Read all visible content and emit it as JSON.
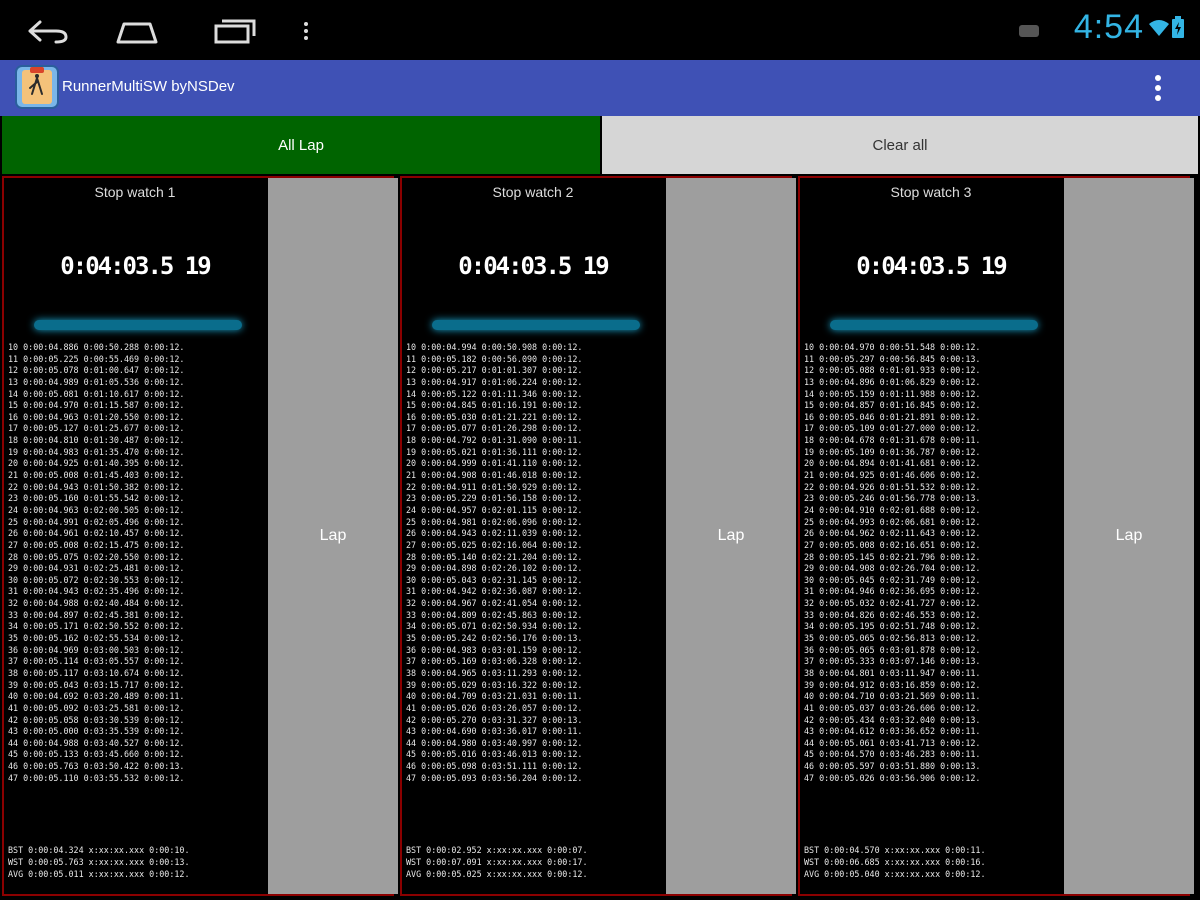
{
  "status_bar": {
    "time": "4:54",
    "icons": [
      "back-icon",
      "home-icon",
      "recent-apps-icon",
      "menu-icon",
      "notification-icon",
      "wifi-icon",
      "battery-icon"
    ],
    "time_color": "#33b5e5"
  },
  "app_bar": {
    "title": "RunnerMultiSW byNSDev",
    "color": "#3f51b5"
  },
  "buttons": {
    "all_lap": "All Lap",
    "clear_all": "Clear all"
  },
  "stopwatches": [
    {
      "title": "Stop watch 1",
      "time": "0:04:03.5 19",
      "lap_label": "Lap",
      "laps": [
        "10 0:00:04.886 0:00:50.288 0:00:12.",
        "11 0:00:05.225 0:00:55.469 0:00:12.",
        "12 0:00:05.078 0:01:00.647 0:00:12.",
        "13 0:00:04.989 0:01:05.536 0:00:12.",
        "14 0:00:05.081 0:01:10.617 0:00:12.",
        "15 0:00:04.970 0:01:15.587 0:00:12.",
        "16 0:00:04.963 0:01:20.550 0:00:12.",
        "17 0:00:05.127 0:01:25.677 0:00:12.",
        "18 0:00:04.810 0:01:30.487 0:00:12.",
        "19 0:00:04.983 0:01:35.470 0:00:12.",
        "20 0:00:04.925 0:01:40.395 0:00:12.",
        "21 0:00:05.008 0:01:45.403 0:00:12.",
        "22 0:00:04.943 0:01:50.382 0:00:12.",
        "23 0:00:05.160 0:01:55.542 0:00:12.",
        "24 0:00:04.963 0:02:00.505 0:00:12.",
        "25 0:00:04.991 0:02:05.496 0:00:12.",
        "26 0:00:04.961 0:02:10.457 0:00:12.",
        "27 0:00:05.008 0:02:15.475 0:00:12.",
        "28 0:00:05.075 0:02:20.550 0:00:12.",
        "29 0:00:04.931 0:02:25.481 0:00:12.",
        "30 0:00:05.072 0:02:30.553 0:00:12.",
        "31 0:00:04.943 0:02:35.496 0:00:12.",
        "32 0:00:04.988 0:02:40.484 0:00:12.",
        "33 0:00:04.897 0:02:45.381 0:00:12.",
        "34 0:00:05.171 0:02:50.552 0:00:12.",
        "35 0:00:05.162 0:02:55.534 0:00:12.",
        "36 0:00:04.969 0:03:00.503 0:00:12.",
        "37 0:00:05.114 0:03:05.557 0:00:12.",
        "38 0:00:05.117 0:03:10.674 0:00:12.",
        "39 0:00:05.043 0:03:15.717 0:00:12.",
        "40 0:00:04.692 0:03:20.489 0:00:11.",
        "41 0:00:05.092 0:03:25.581 0:00:12.",
        "42 0:00:05.058 0:03:30.539 0:00:12.",
        "43 0:00:05.000 0:03:35.539 0:00:12.",
        "44 0:00:04.988 0:03:40.527 0:00:12.",
        "45 0:00:05.133 0:03:45.660 0:00:12.",
        "46 0:00:05.763 0:03:50.422 0:00:13.",
        "47 0:00:05.110 0:03:55.532 0:00:12."
      ],
      "stats": [
        "BST 0:00:04.324 x:xx:xx.xxx 0:00:10.",
        "WST 0:00:05.763 x:xx:xx.xxx 0:00:13.",
        "AVG 0:00:05.011 x:xx:xx.xxx 0:00:12."
      ]
    },
    {
      "title": "Stop watch 2",
      "time": "0:04:03.5 19",
      "lap_label": "Lap",
      "laps": [
        "10 0:00:04.994 0:00:50.908 0:00:12.",
        "11 0:00:05.182 0:00:56.090 0:00:12.",
        "12 0:00:05.217 0:01:01.307 0:00:12.",
        "13 0:00:04.917 0:01:06.224 0:00:12.",
        "14 0:00:05.122 0:01:11.346 0:00:12.",
        "15 0:00:04.845 0:01:16.191 0:00:12.",
        "16 0:00:05.030 0:01:21.221 0:00:12.",
        "17 0:00:05.077 0:01:26.298 0:00:12.",
        "18 0:00:04.792 0:01:31.090 0:00:11.",
        "19 0:00:05.021 0:01:36.111 0:00:12.",
        "20 0:00:04.999 0:01:41.110 0:00:12.",
        "21 0:00:04.908 0:01:46.018 0:00:12.",
        "22 0:00:04.911 0:01:50.929 0:00:12.",
        "23 0:00:05.229 0:01:56.158 0:00:12.",
        "24 0:00:04.957 0:02:01.115 0:00:12.",
        "25 0:00:04.981 0:02:06.096 0:00:12.",
        "26 0:00:04.943 0:02:11.039 0:00:12.",
        "27 0:00:05.025 0:02:16.064 0:00:12.",
        "28 0:00:05.140 0:02:21.204 0:00:12.",
        "29 0:00:04.898 0:02:26.102 0:00:12.",
        "30 0:00:05.043 0:02:31.145 0:00:12.",
        "31 0:00:04.942 0:02:36.087 0:00:12.",
        "32 0:00:04.967 0:02:41.054 0:00:12.",
        "33 0:00:04.809 0:02:45.863 0:00:12.",
        "34 0:00:05.071 0:02:50.934 0:00:12.",
        "35 0:00:05.242 0:02:56.176 0:00:13.",
        "36 0:00:04.983 0:03:01.159 0:00:12.",
        "37 0:00:05.169 0:03:06.328 0:00:12.",
        "38 0:00:04.965 0:03:11.293 0:00:12.",
        "39 0:00:05.029 0:03:16.322 0:00:12.",
        "40 0:00:04.709 0:03:21.031 0:00:11.",
        "41 0:00:05.026 0:03:26.057 0:00:12.",
        "42 0:00:05.270 0:03:31.327 0:00:13.",
        "43 0:00:04.690 0:03:36.017 0:00:11.",
        "44 0:00:04.980 0:03:40.997 0:00:12.",
        "45 0:00:05.016 0:03:46.013 0:00:12.",
        "46 0:00:05.098 0:03:51.111 0:00:12.",
        "47 0:00:05.093 0:03:56.204 0:00:12."
      ],
      "stats": [
        "BST 0:00:02.952 x:xx:xx.xxx 0:00:07.",
        "WST 0:00:07.091 x:xx:xx.xxx 0:00:17.",
        "AVG 0:00:05.025 x:xx:xx.xxx 0:00:12."
      ]
    },
    {
      "title": "Stop watch 3",
      "time": "0:04:03.5 19",
      "lap_label": "Lap",
      "laps": [
        "10 0:00:04.970 0:00:51.548 0:00:12.",
        "11 0:00:05.297 0:00:56.845 0:00:13.",
        "12 0:00:05.088 0:01:01.933 0:00:12.",
        "13 0:00:04.896 0:01:06.829 0:00:12.",
        "14 0:00:05.159 0:01:11.988 0:00:12.",
        "15 0:00:04.857 0:01:16.845 0:00:12.",
        "16 0:00:05.046 0:01:21.891 0:00:12.",
        "17 0:00:05.109 0:01:27.000 0:00:12.",
        "18 0:00:04.678 0:01:31.678 0:00:11.",
        "19 0:00:05.109 0:01:36.787 0:00:12.",
        "20 0:00:04.894 0:01:41.681 0:00:12.",
        "21 0:00:04.925 0:01:46.606 0:00:12.",
        "22 0:00:04.926 0:01:51.532 0:00:12.",
        "23 0:00:05.246 0:01:56.778 0:00:13.",
        "24 0:00:04.910 0:02:01.688 0:00:12.",
        "25 0:00:04.993 0:02:06.681 0:00:12.",
        "26 0:00:04.962 0:02:11.643 0:00:12.",
        "27 0:00:05.008 0:02:16.651 0:00:12.",
        "28 0:00:05.145 0:02:21.796 0:00:12.",
        "29 0:00:04.908 0:02:26.704 0:00:12.",
        "30 0:00:05.045 0:02:31.749 0:00:12.",
        "31 0:00:04.946 0:02:36.695 0:00:12.",
        "32 0:00:05.032 0:02:41.727 0:00:12.",
        "33 0:00:04.826 0:02:46.553 0:00:12.",
        "34 0:00:05.195 0:02:51.748 0:00:12.",
        "35 0:00:05.065 0:02:56.813 0:00:12.",
        "36 0:00:05.065 0:03:01.878 0:00:12.",
        "37 0:00:05.333 0:03:07.146 0:00:13.",
        "38 0:00:04.801 0:03:11.947 0:00:11.",
        "39 0:00:04.912 0:03:16.859 0:00:12.",
        "40 0:00:04.710 0:03:21.569 0:00:11.",
        "41 0:00:05.037 0:03:26.606 0:00:12.",
        "42 0:00:05.434 0:03:32.040 0:00:13.",
        "43 0:00:04.612 0:03:36.652 0:00:11.",
        "44 0:00:05.061 0:03:41.713 0:00:12.",
        "45 0:00:04.570 0:03:46.283 0:00:11.",
        "46 0:00:05.597 0:03:51.880 0:00:13.",
        "47 0:00:05.026 0:03:56.906 0:00:12."
      ],
      "stats": [
        "BST 0:00:04.570 x:xx:xx.xxx 0:00:11.",
        "WST 0:00:06.685 x:xx:xx.xxx 0:00:16.",
        "AVG 0:00:05.040 x:xx:xx.xxx 0:00:12."
      ]
    }
  ]
}
